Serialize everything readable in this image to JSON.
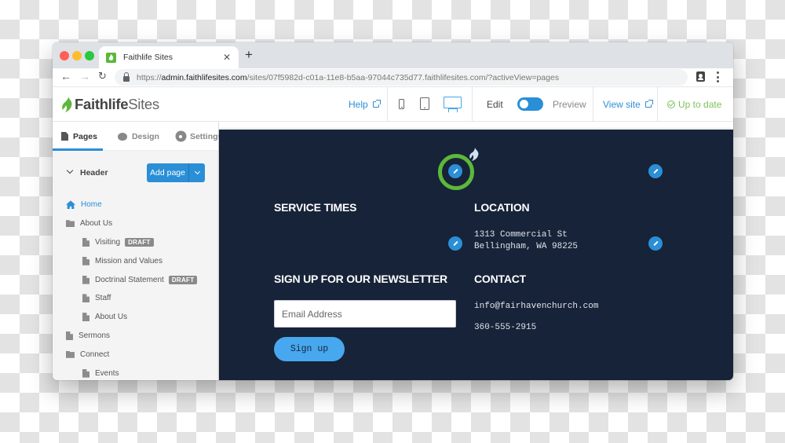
{
  "browser": {
    "tab_title": "Faithlife Sites",
    "url_scheme": "https://",
    "url_host": "admin.faithlifesites.com",
    "url_path": "/sites/07f5982d-c01a-11e8-b5aa-97044c735d77.faithlifesites.com/?activeView=pages"
  },
  "header": {
    "logo_bold": "Faithlife",
    "logo_light": "Sites",
    "help_label": "Help",
    "edit_label": "Edit",
    "preview_label": "Preview",
    "view_site_label": "View site",
    "status_label": "Up to date",
    "mode_toggle_on": "Edit",
    "active_device": "desktop"
  },
  "sidebar": {
    "tabs": [
      {
        "label": "Pages",
        "icon": "document-icon",
        "active": true
      },
      {
        "label": "Design",
        "icon": "palette-icon",
        "active": false
      },
      {
        "label": "Settings",
        "icon": "gear-icon",
        "active": false
      }
    ],
    "group_label": "Header",
    "add_page_label": "Add page",
    "tree": [
      {
        "label": "Home",
        "icon": "home-icon",
        "level": 0,
        "active": true,
        "badge": ""
      },
      {
        "label": "About Us",
        "icon": "folder-icon",
        "level": 0,
        "active": false,
        "badge": ""
      },
      {
        "label": "Visiting",
        "icon": "page-icon",
        "level": 1,
        "active": false,
        "badge": "DRAFT"
      },
      {
        "label": "Mission and Values",
        "icon": "page-icon",
        "level": 1,
        "active": false,
        "badge": ""
      },
      {
        "label": "Doctrinal Statement",
        "icon": "page-icon",
        "level": 1,
        "active": false,
        "badge": "DRAFT"
      },
      {
        "label": "Staff",
        "icon": "page-icon",
        "level": 1,
        "active": false,
        "badge": ""
      },
      {
        "label": "About Us",
        "icon": "page-icon",
        "level": 1,
        "active": false,
        "badge": ""
      },
      {
        "label": "Sermons",
        "icon": "page-icon",
        "level": 0,
        "active": false,
        "badge": ""
      },
      {
        "label": "Connect",
        "icon": "folder-icon",
        "level": 0,
        "active": false,
        "badge": ""
      },
      {
        "label": "Events",
        "icon": "page-icon",
        "level": 1,
        "active": false,
        "badge": ""
      }
    ]
  },
  "preview": {
    "service_times_heading": "SERVICE TIMES",
    "location_heading": "LOCATION",
    "address_line1": "1313 Commercial St",
    "address_line2": "Bellingham, WA 98225",
    "newsletter_heading": "SIGN UP FOR OUR NEWSLETTER",
    "email_placeholder": "Email Address",
    "email_value": "",
    "signup_label": "Sign up",
    "contact_heading": "CONTACT",
    "contact_email": "info@fairhavenchurch.com",
    "contact_phone": "360-555-2915"
  },
  "colors": {
    "accent": "#2a8fd6",
    "status_green": "#7cc35b",
    "focus_ring": "#5cb83a",
    "footer_bg": "#172338",
    "signup_button": "#47a8f0"
  }
}
